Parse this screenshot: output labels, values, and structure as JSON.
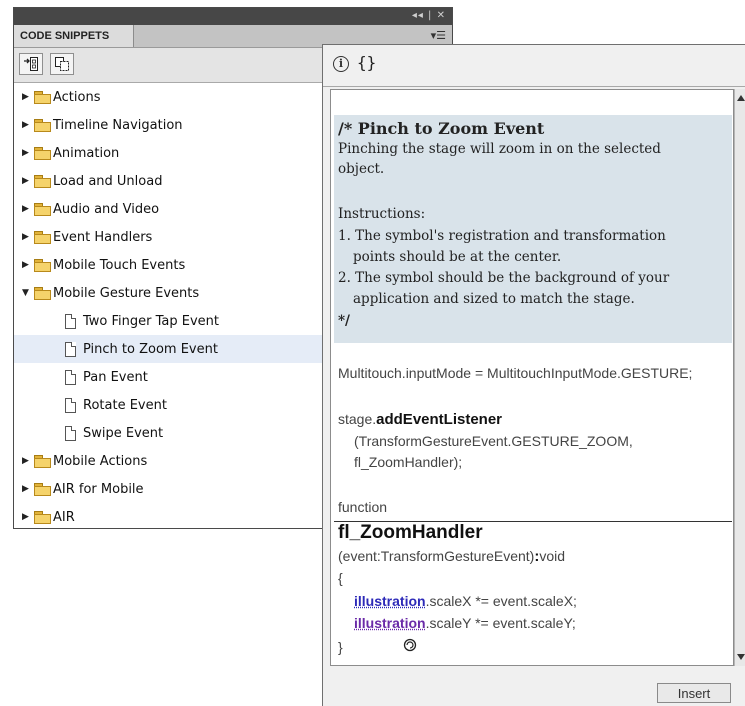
{
  "panel": {
    "tab_label": "CODE SNIPPETS",
    "titlebar_controls": "◂◂ | ✕",
    "tree": [
      {
        "label": "Actions",
        "kind": "folder",
        "expanded": false
      },
      {
        "label": "Timeline Navigation",
        "kind": "folder",
        "expanded": false
      },
      {
        "label": "Animation",
        "kind": "folder",
        "expanded": false
      },
      {
        "label": "Load and Unload",
        "kind": "folder",
        "expanded": false
      },
      {
        "label": "Audio and Video",
        "kind": "folder",
        "expanded": false
      },
      {
        "label": "Event Handlers",
        "kind": "folder",
        "expanded": false
      },
      {
        "label": "Mobile Touch Events",
        "kind": "folder",
        "expanded": false
      },
      {
        "label": "Mobile Gesture Events",
        "kind": "folder",
        "expanded": true
      },
      {
        "label": "Two Finger Tap Event",
        "kind": "snippet"
      },
      {
        "label": "Pinch to Zoom Event",
        "kind": "snippet",
        "selected": true
      },
      {
        "label": "Pan Event",
        "kind": "snippet"
      },
      {
        "label": "Rotate Event",
        "kind": "snippet"
      },
      {
        "label": "Swipe Event",
        "kind": "snippet"
      },
      {
        "label": "Mobile Actions",
        "kind": "folder",
        "expanded": false
      },
      {
        "label": "AIR for Mobile",
        "kind": "folder",
        "expanded": false
      },
      {
        "label": "AIR",
        "kind": "folder",
        "expanded": false
      }
    ]
  },
  "popup": {
    "icons": [
      "info-icon",
      "braces-icon"
    ],
    "comment": {
      "title": "/* Pinch to Zoom Event",
      "description_1": "Pinching the stage will zoom in on the selected",
      "description_2": "object.",
      "instructions_label": "Instructions:",
      "step1_a": "1. The symbol's registration and transformation",
      "step1_b": "points should be at the center.",
      "step2_a": "2. The symbol should be the background of your",
      "step2_b": "application and sized to match the stage.",
      "close": "*/"
    },
    "code": {
      "line_input_mode": "Multitouch.inputMode = MultitouchInputMode.GESTURE;",
      "stage_prefix": "stage.",
      "add_event_listener": "addEventListener",
      "listener_arg_1": "(TransformGestureEvent.GESTURE_ZOOM,",
      "listener_arg_2": "fl_ZoomHandler);",
      "function_kw": "function",
      "handler_name": "fl_ZoomHandler",
      "sig_event": "(event:TransformGestureEvent)",
      "sig_colon": ":",
      "sig_void": "void",
      "open_brace": "{",
      "instance_name_1": "illustration",
      "line_scale_x": ".scaleX *= event.scaleX;",
      "instance_name_2": "illustration",
      "line_scale_y": ".scaleY *= event.scaleY;",
      "close_brace": "}"
    },
    "insert_label": "Insert",
    "link_color": "#2c29b8",
    "comment_bg": "#d9e3ea"
  }
}
